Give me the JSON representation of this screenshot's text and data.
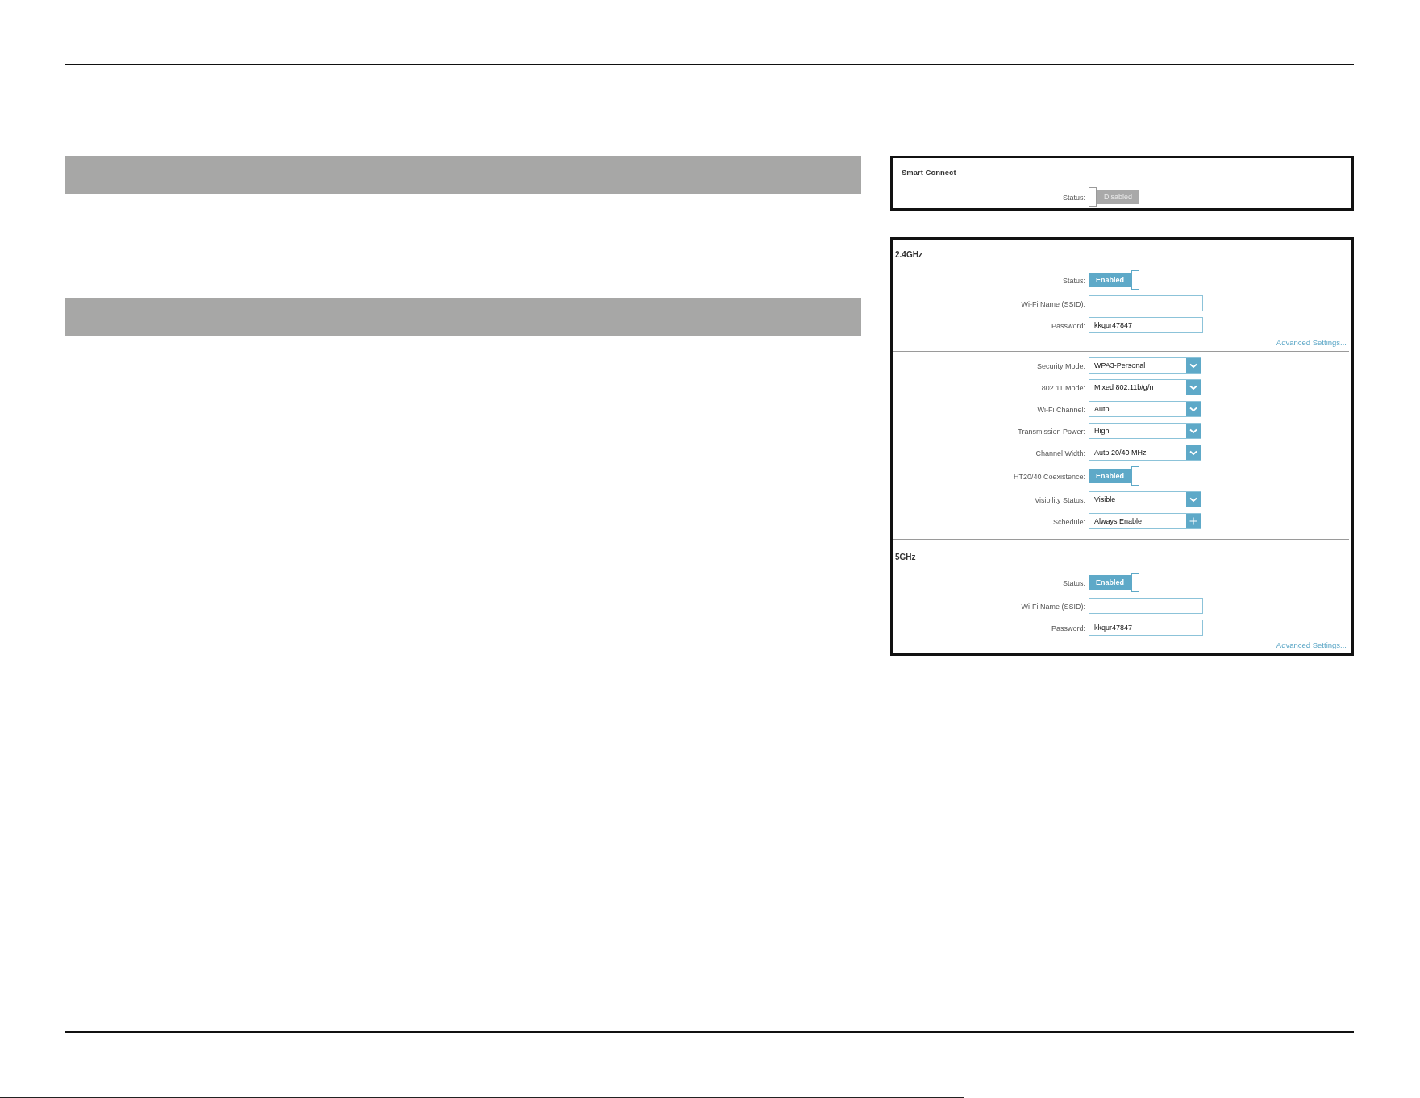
{
  "smart_connect": {
    "title": "Smart Connect",
    "rows": [
      {
        "kind": "toggle",
        "label": "Status:",
        "on": false,
        "text": "Disabled"
      }
    ]
  },
  "wireless": {
    "sections": [
      {
        "title": "2.4GHz",
        "rows": [
          {
            "kind": "toggle",
            "label": "Status:",
            "on": true,
            "text": "Enabled"
          },
          {
            "kind": "input",
            "label": "Wi-Fi Name (SSID):"
          },
          {
            "kind": "input",
            "label": "Password:",
            "value": "kkqur47847"
          }
        ],
        "link": "Advanced Settings..."
      },
      {
        "rows": [
          {
            "kind": "select",
            "label": "Security Mode:",
            "value": "WPA3-Personal"
          },
          {
            "kind": "select",
            "label": "802.11 Mode:",
            "value": "Mixed 802.11b/g/n"
          },
          {
            "kind": "select",
            "label": "Wi-Fi Channel:",
            "value": "Auto"
          },
          {
            "kind": "select",
            "label": "Transmission Power:",
            "value": "High"
          },
          {
            "kind": "select",
            "label": "Channel Width:",
            "value": "Auto 20/40 MHz"
          },
          {
            "kind": "toggle",
            "label": "HT20/40 Coexistence:",
            "on": true,
            "text": "Enabled"
          },
          {
            "kind": "select",
            "label": "Visibility Status:",
            "value": "Visible"
          },
          {
            "kind": "schedule",
            "label": "Schedule:",
            "value": "Always Enable"
          }
        ]
      },
      {
        "title": "5GHz",
        "rows": [
          {
            "kind": "toggle",
            "label": "Status:",
            "on": true,
            "text": "Enabled"
          },
          {
            "kind": "input",
            "label": "Wi-Fi Name (SSID):"
          },
          {
            "kind": "input",
            "label": "Password:",
            "value": "kkqur47847"
          }
        ],
        "link": "Advanced Settings..."
      }
    ]
  }
}
